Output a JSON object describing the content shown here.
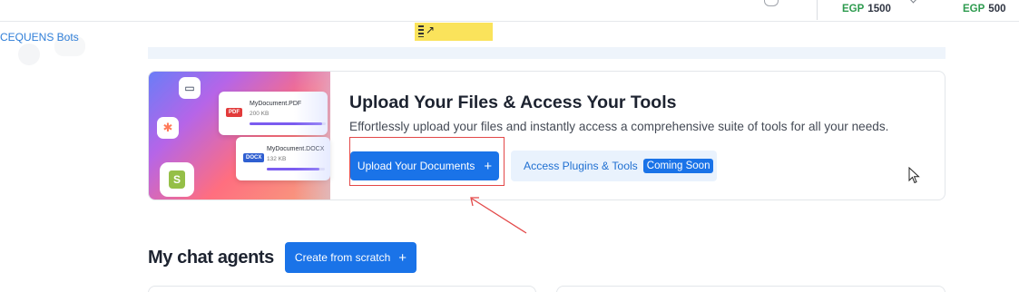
{
  "topbar": {
    "balances": [
      {
        "currency": "EGP",
        "amount": "1500"
      },
      {
        "currency": "EGP",
        "amount": "500"
      }
    ]
  },
  "sidebar": {
    "label": "CEQUENS Bots"
  },
  "banner": {
    "title": "Upload Your Files & Access Your Tools",
    "subtitle": "Effortlessly upload your files and instantly access a comprehensive suite of tools for all your needs.",
    "upload_label": "Upload Your Documents",
    "upload_icon": "+",
    "plugins_label": "Access Plugins & Tools",
    "plugins_badge": "Coming Soon",
    "files": [
      {
        "badge": "PDF",
        "name": "MyDocument.PDF",
        "size": "200 KB",
        "progress": 0.95
      },
      {
        "badge": "DOCX",
        "name": "MyDocument.DOCX",
        "size": "132 KB",
        "progress": 0.9
      }
    ],
    "art_icons": [
      "inbox-icon",
      "hubspot-icon",
      "shopify-icon"
    ]
  },
  "agents": {
    "title": "My chat agents",
    "create_label": "Create from scratch",
    "create_icon": "+"
  },
  "sticky_note": {
    "icon": "↗"
  },
  "colors": {
    "primary": "#1a73e8",
    "currency": "#2e9b4f",
    "annotation": "#e34848",
    "sticky": "#fae35b"
  }
}
